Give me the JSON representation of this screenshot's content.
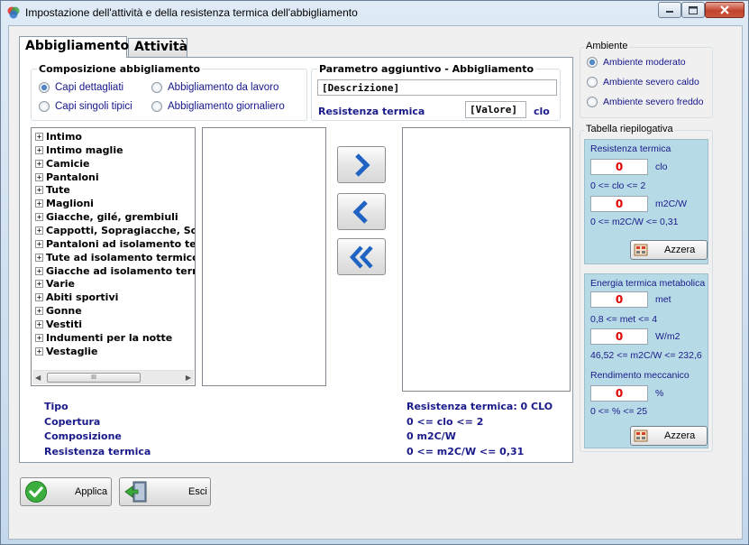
{
  "window": {
    "title": "Impostazione dell'attività e della resistenza termica dell'abbigliamento"
  },
  "tabs": [
    {
      "label": "Abbigliamento",
      "active": true
    },
    {
      "label": "Attività",
      "active": false
    }
  ],
  "composizione": {
    "title": "Composizione abbigliamento",
    "options": [
      {
        "label": "Capi dettagliati",
        "checked": true
      },
      {
        "label": "Capi singoli tipici",
        "checked": false
      },
      {
        "label": "Abbigliamento da lavoro",
        "checked": false
      },
      {
        "label": "Abbigliamento giornaliero",
        "checked": false
      }
    ]
  },
  "parametro": {
    "title": "Parametro aggiuntivo - Abbigliamento",
    "descrizione_value": "[Descrizione]",
    "resistenza_label": "Resistenza termica",
    "valore_value": "[Valore]",
    "unit": "clo"
  },
  "tree": {
    "expander": "+",
    "items": [
      "Intimo",
      "Intimo maglie",
      "Camicie",
      "Pantaloni",
      "Tute",
      "Maglioni",
      "Giacche, gilé, grembiuli",
      "Cappotti, Sopragiacche, Sopra",
      "Pantaloni ad isolamento term",
      "Tute ad isolamento termico",
      "Giacche ad isolamento termi",
      "Varie",
      "Abiti sportivi",
      "Gonne",
      "Vestiti",
      "Indumenti per la notte",
      "Vestaglie"
    ],
    "scroll_grip": "III"
  },
  "info_left": [
    "Tipo",
    "Copertura",
    "Composizione",
    "Resistenza termica"
  ],
  "info_right": [
    "Resistenza termica: 0 CLO",
    "0 <= clo <= 2",
    "0 m2C/W",
    "0 <= m2C/W <= 0,31"
  ],
  "ambiente": {
    "title": "Ambiente",
    "options": [
      {
        "label": "Ambiente moderato",
        "checked": true
      },
      {
        "label": "Ambiente severo caldo",
        "checked": false
      },
      {
        "label": "Ambiente severo freddo",
        "checked": false
      }
    ]
  },
  "riepilogo": {
    "title": "Tabella riepilogativa",
    "resistenza": {
      "title": "Resistenza termica",
      "clo_value": "0",
      "clo_unit": "clo",
      "clo_range": "0 <= clo <= 2",
      "m2cw_value": "0",
      "m2cw_unit": "m2C/W",
      "m2cw_range": "0 <= m2C/W <= 0,31",
      "button": "Azzera"
    },
    "energia": {
      "title": "Energia termica metabolica",
      "met_value": "0",
      "met_unit": "met",
      "met_range": "0,8 <= met <= 4",
      "wm2_value": "0",
      "wm2_unit": "W/m2",
      "wm2_range": "46,52 <= m2C/W <= 232,6",
      "rendimento_title": "Rendimento meccanico",
      "pct_value": "0",
      "pct_unit": "%",
      "pct_range": "0 <= % <= 25",
      "button": "Azzera"
    }
  },
  "buttons": {
    "applica": "Applica",
    "esci": "Esci"
  },
  "colors": {
    "accent_blue": "#1a1a8a",
    "value_red": "#e00000",
    "panel_blue": "#b6dbe6"
  }
}
